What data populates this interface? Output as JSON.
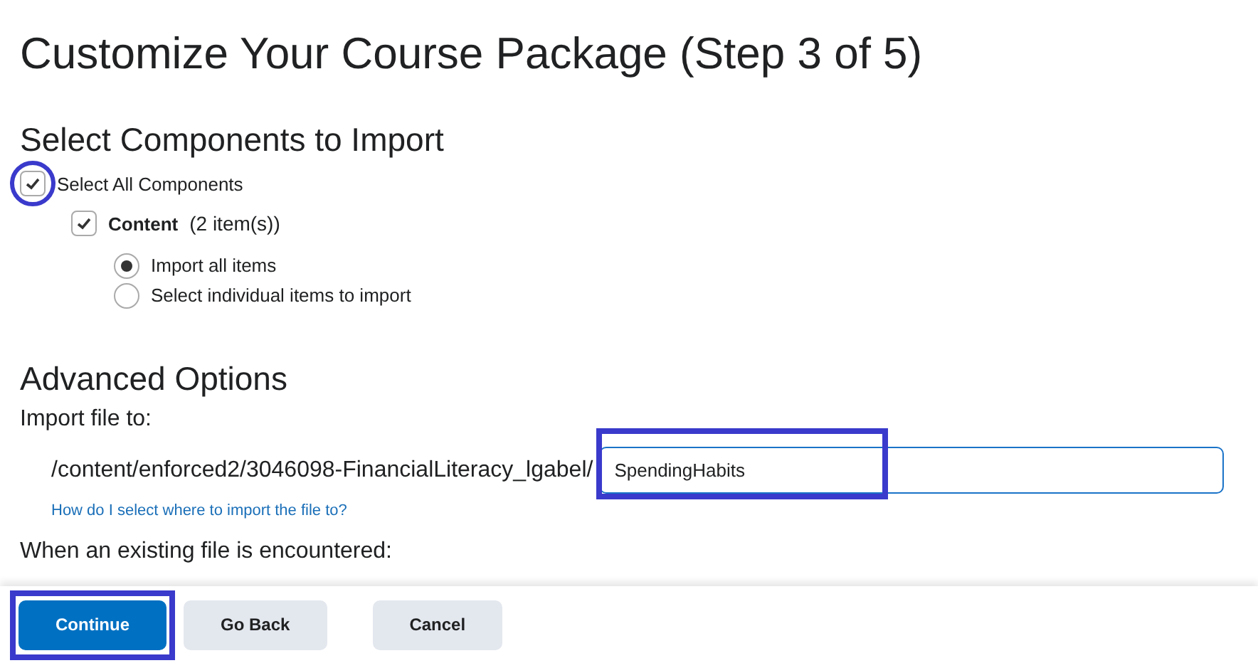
{
  "title": "Customize Your Course Package (Step 3 of 5)",
  "components": {
    "heading": "Select Components to Import",
    "select_all": {
      "label": "Select All Components",
      "checked": true,
      "highlighted": true
    },
    "items": [
      {
        "label": "Content",
        "count": "(2 item(s))",
        "checked": true,
        "options": [
          {
            "label": "Import all items",
            "selected": true
          },
          {
            "label": "Select individual items to import",
            "selected": false
          }
        ]
      }
    ]
  },
  "advanced": {
    "heading": "Advanced Options",
    "import_label": "Import file to:",
    "path": "/content/enforced2/3046098-FinancialLiteracy_lgabel/",
    "field": {
      "value": "SpendingHabits",
      "highlighted": true
    },
    "help_link": "How do I select where to import the file to?",
    "existing_label": "When an existing file is encountered:"
  },
  "buttons": [
    {
      "label": "Continue",
      "kind": "primary",
      "highlighted": true
    },
    {
      "label": "Go Back",
      "kind": "secondary",
      "highlighted": false
    },
    {
      "label": "Cancel",
      "kind": "secondary",
      "highlighted": false
    }
  ]
}
